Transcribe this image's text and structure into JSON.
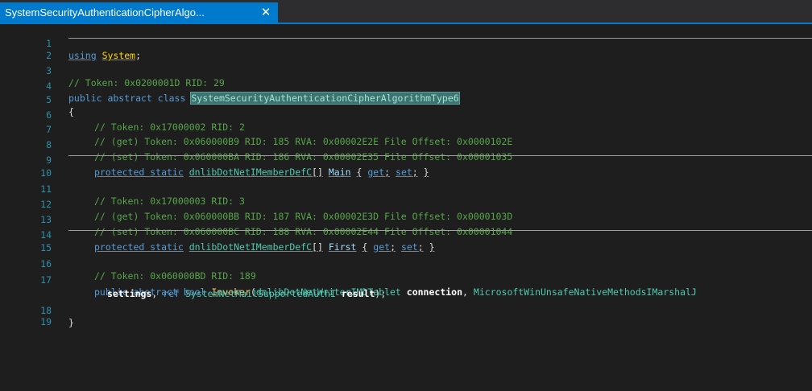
{
  "tab": {
    "title": "SystemSecurityAuthenticationCipherAlgo...",
    "close_glyph": "✕"
  },
  "lines": [
    {
      "n": "1"
    },
    {
      "n": "2"
    },
    {
      "n": "3"
    },
    {
      "n": "4"
    },
    {
      "n": "5"
    },
    {
      "n": "6"
    },
    {
      "n": "7"
    },
    {
      "n": "8"
    },
    {
      "n": "9"
    },
    {
      "n": "10"
    },
    {
      "n": "11"
    },
    {
      "n": "12"
    },
    {
      "n": "13"
    },
    {
      "n": "14"
    },
    {
      "n": "15"
    },
    {
      "n": "16"
    },
    {
      "n": "17"
    },
    {
      "n": "18"
    },
    {
      "n": "19"
    }
  ],
  "code": {
    "l1": {
      "kw": "using",
      "ns": "System",
      "semi": ";"
    },
    "l3": "// Token: 0x0200001D RID: 29",
    "l4": {
      "kw": "public abstract class",
      "name": "SystemSecurityAuthenticationCipherAlgorithmType6"
    },
    "l5": "{",
    "l6": "// Token: 0x17000002 RID: 2",
    "l7": "// (get) Token: 0x060000B9 RID: 185 RVA: 0x00002E2E File Offset: 0x0000102E",
    "l8": "// (set) Token: 0x060000BA RID: 186 RVA: 0x00002E35 File Offset: 0x00001035",
    "l9": {
      "kw": "protected static",
      "type": "dnlibDotNetIMemberDefC",
      "arr": "[]",
      "name": "Main",
      "acc1": "{",
      "get": "get",
      "s1": ";",
      "set": "set",
      "s2": ";",
      "acc2": "}"
    },
    "l11": "// Token: 0x17000003 RID: 3",
    "l12": "// (get) Token: 0x060000BB RID: 187 RVA: 0x00002E3D File Offset: 0x0000103D",
    "l13": "// (set) Token: 0x060000BC RID: 188 RVA: 0x00002E44 File Offset: 0x00001044",
    "l14": {
      "kw": "protected static",
      "type": "dnlibDotNetIMemberDefC",
      "arr": "[]",
      "name": "First",
      "acc1": "{",
      "get": "get",
      "s1": ";",
      "set": "set",
      "s2": ";",
      "acc2": "}"
    },
    "l16": "// Token: 0x060000BD RID: 189",
    "l17": {
      "kw": "public abstract bool",
      "method": "Invoker",
      "p1type": "dnlibDotNetWriterIMDTablet",
      "p1name": "connection",
      "comma": ",",
      "p2type": "MicrosoftWinUnsafeNativeMethodsIMarshalJ"
    },
    "l17b": {
      "p2name": "settings",
      "comma": ",",
      "ref": "ref",
      "p3type": "SystemNetMailSupportedAuthI",
      "p3name": "result",
      "end": ");"
    },
    "l18": "}"
  }
}
